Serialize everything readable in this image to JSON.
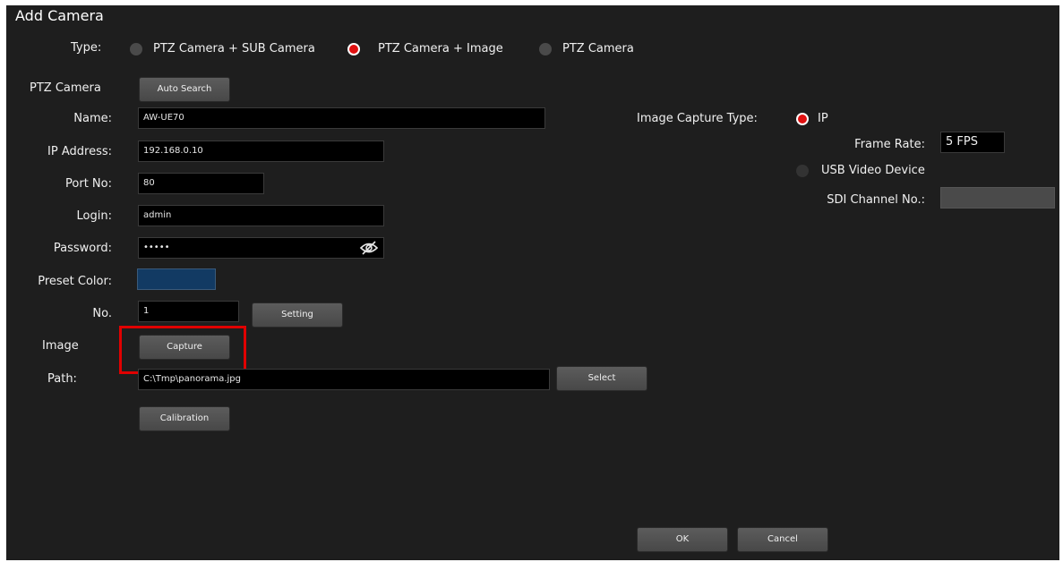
{
  "dialog": {
    "title": "Add Camera"
  },
  "type_row": {
    "label": "Type:",
    "options": [
      {
        "label": "PTZ Camera + SUB Camera",
        "selected": false
      },
      {
        "label": "PTZ Camera + Image",
        "selected": true
      },
      {
        "label": "PTZ Camera",
        "selected": false
      }
    ]
  },
  "ptz": {
    "section_label": "PTZ Camera",
    "auto_search_label": "Auto Search",
    "name_label": "Name:",
    "name_value": "AW-UE70",
    "ip_label": "IP Address:",
    "ip_value": "192.168.0.10",
    "port_label": "Port No:",
    "port_value": "80",
    "login_label": "Login:",
    "login_value": "admin",
    "password_label": "Password:",
    "password_value": "•••••",
    "preset_color_label": "Preset Color:",
    "preset_color_value": "#123a63",
    "no_label": "No.",
    "no_value": "1",
    "setting_label": "Setting"
  },
  "image": {
    "section_label": "Image",
    "capture_label": "Capture",
    "path_label": "Path:",
    "path_value": "C:\\Tmp\\panorama.jpg",
    "select_label": "Select",
    "calibration_label": "Calibration"
  },
  "capture_type": {
    "label": "Image Capture Type:",
    "ip_label": "IP",
    "ip_selected": true,
    "frame_rate_label": "Frame Rate:",
    "frame_rate_value": "5 FPS",
    "usb_label": "USB Video Device",
    "usb_selected": false,
    "sdi_label": "SDI Channel No.:",
    "sdi_value": ""
  },
  "footer": {
    "ok_label": "OK",
    "cancel_label": "Cancel"
  },
  "colors": {
    "selected_radio": "#e01010",
    "highlight": "#e00000",
    "background": "#1e1e1e"
  },
  "icons": {
    "password_toggle": "eye-slash-icon"
  }
}
